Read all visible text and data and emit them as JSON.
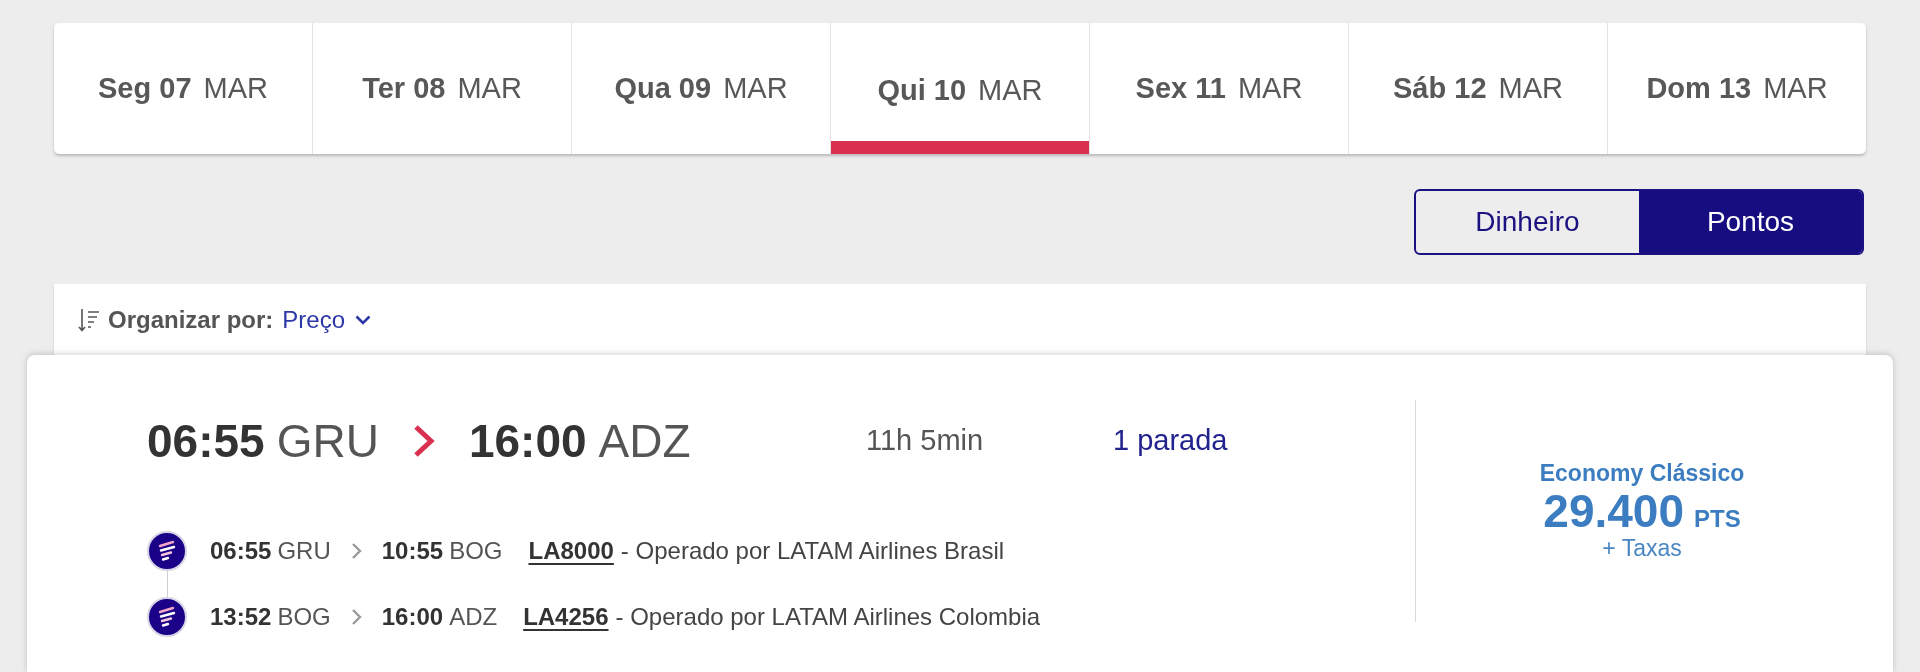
{
  "date_tabs": [
    {
      "day": "Seg 07",
      "month": "MAR",
      "selected": false
    },
    {
      "day": "Ter 08",
      "month": "MAR",
      "selected": false
    },
    {
      "day": "Qua 09",
      "month": "MAR",
      "selected": false
    },
    {
      "day": "Qui 10",
      "month": "MAR",
      "selected": true
    },
    {
      "day": "Sex 11",
      "month": "MAR",
      "selected": false
    },
    {
      "day": "Sáb 12",
      "month": "MAR",
      "selected": false
    },
    {
      "day": "Dom 13",
      "month": "MAR",
      "selected": false
    }
  ],
  "currency_toggle": [
    {
      "label": "Dinheiro",
      "selected": false
    },
    {
      "label": "Pontos",
      "selected": true
    }
  ],
  "sort_bar": {
    "label": "Organizar por:",
    "value": "Preço"
  },
  "flight": {
    "departure_time": "06:55",
    "origin": "GRU",
    "arrival_time": "16:00",
    "destination": "ADZ",
    "duration": "11h 5min",
    "stops": "1 parada",
    "segments": [
      {
        "departure_time": "06:55",
        "origin": "GRU",
        "arrival_time": "10:55",
        "destination": "BOG",
        "flight_number": "LA8000",
        "operator": "- Operado por LATAM Airlines Brasil"
      },
      {
        "departure_time": "13:52",
        "origin": "BOG",
        "arrival_time": "16:00",
        "destination": "ADZ",
        "flight_number": "LA4256",
        "operator": "- Operado por LATAM Airlines Colombia"
      }
    ],
    "fare": {
      "cabin": "Economy Clássico",
      "points": "29.400",
      "unit": "PTS",
      "note": "+ Taxas"
    }
  }
}
